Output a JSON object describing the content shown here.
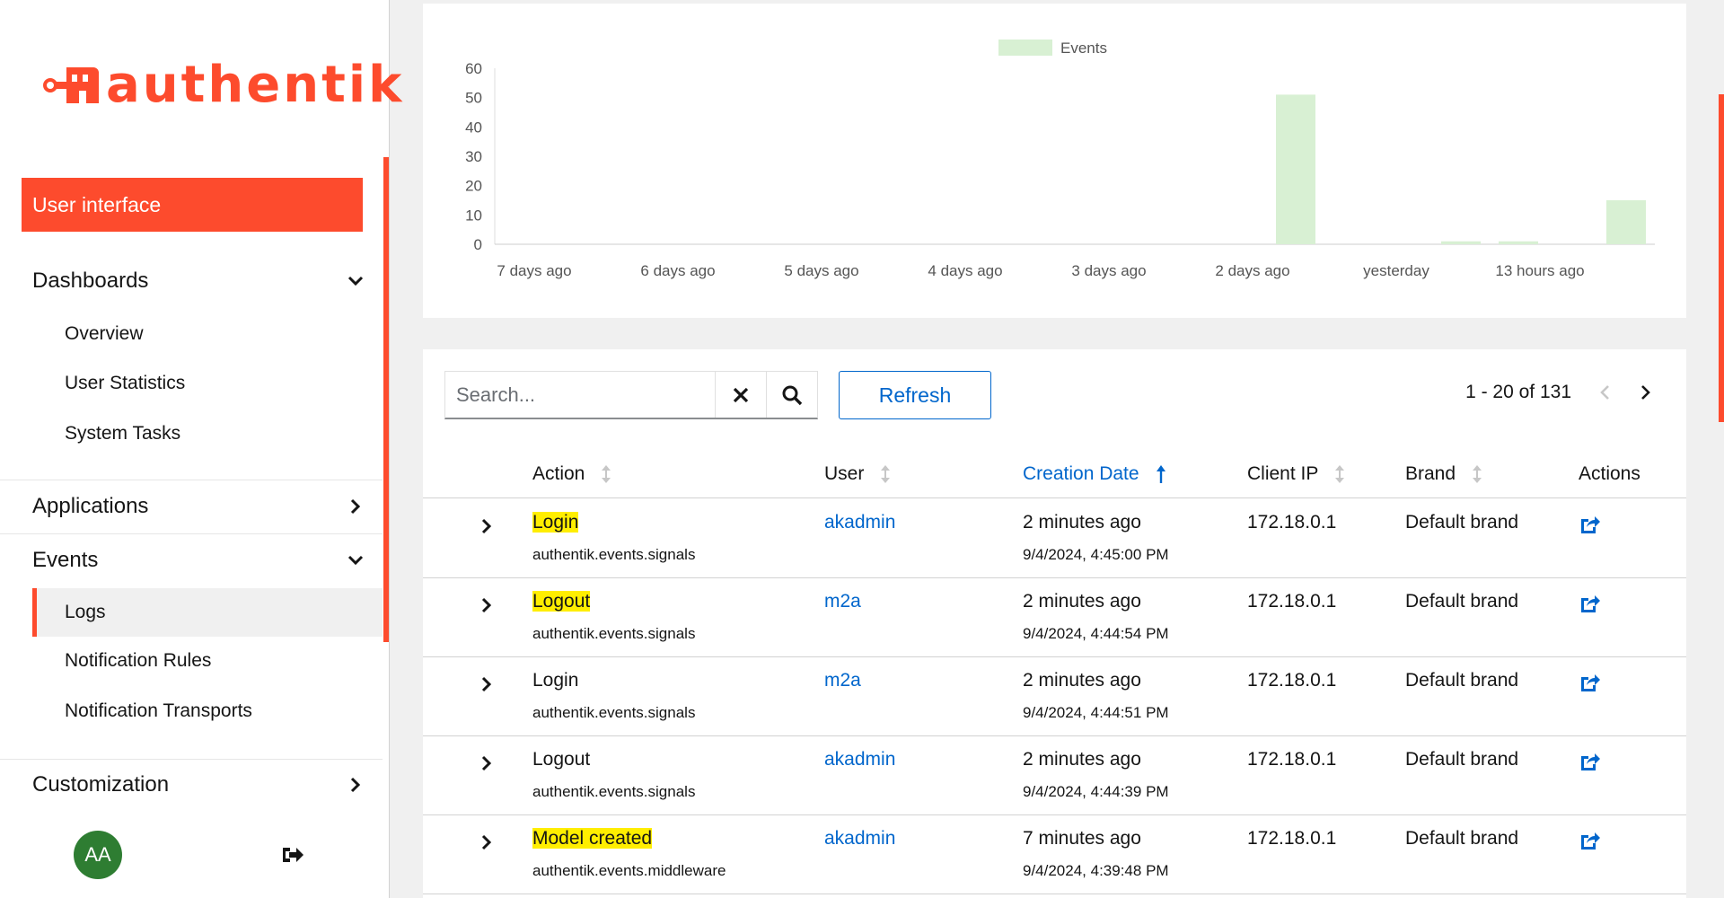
{
  "brand": {
    "logo_text": "authentik",
    "accent": "#fd4b2d"
  },
  "sidebar": {
    "user_interface": "User interface",
    "groups": {
      "dashboards": "Dashboards",
      "applications": "Applications",
      "events": "Events",
      "customization": "Customization"
    },
    "dashboards_items": [
      "Overview",
      "User Statistics",
      "System Tasks"
    ],
    "events_items": [
      "Logs",
      "Notification Rules",
      "Notification Transports"
    ],
    "active_item": "Logs",
    "avatar_initials": "AA"
  },
  "chart_data": {
    "type": "bar",
    "legend": "Events",
    "categories": [
      "7 days ago",
      "6 days ago",
      "5 days ago",
      "4 days ago",
      "3 days ago",
      "2 days ago",
      "yesterday",
      "13 hours ago"
    ],
    "ylim": [
      0,
      60
    ],
    "yticks": [
      0,
      10,
      20,
      30,
      40,
      50,
      60
    ],
    "bars": [
      {
        "x": 5.3,
        "value": 51
      },
      {
        "x": 6.45,
        "value": 1
      },
      {
        "x": 6.85,
        "value": 1
      },
      {
        "x": 7.6,
        "value": 15
      }
    ],
    "bar_color": "#d8f0d3"
  },
  "toolbar": {
    "search_placeholder": "Search...",
    "refresh_label": "Refresh",
    "pagination": "1 - 20 of 131"
  },
  "table": {
    "columns": {
      "action": "Action",
      "user": "User",
      "creation_date": "Creation Date",
      "client_ip": "Client IP",
      "brand": "Brand",
      "actions": "Actions"
    },
    "rows": [
      {
        "action": "Login",
        "highlight": true,
        "app": "authentik.events.signals",
        "user": "akadmin",
        "rel": "2 minutes ago",
        "abs": "9/4/2024, 4:45:00 PM",
        "ip": "172.18.0.1",
        "brand": "Default brand"
      },
      {
        "action": "Logout",
        "highlight": true,
        "app": "authentik.events.signals",
        "user": "m2a",
        "rel": "2 minutes ago",
        "abs": "9/4/2024, 4:44:54 PM",
        "ip": "172.18.0.1",
        "brand": "Default brand"
      },
      {
        "action": "Login",
        "highlight": false,
        "app": "authentik.events.signals",
        "user": "m2a",
        "rel": "2 minutes ago",
        "abs": "9/4/2024, 4:44:51 PM",
        "ip": "172.18.0.1",
        "brand": "Default brand"
      },
      {
        "action": "Logout",
        "highlight": false,
        "app": "authentik.events.signals",
        "user": "akadmin",
        "rel": "2 minutes ago",
        "abs": "9/4/2024, 4:44:39 PM",
        "ip": "172.18.0.1",
        "brand": "Default brand"
      },
      {
        "action": "Model created",
        "highlight": true,
        "app": "authentik.events.middleware",
        "user": "akadmin",
        "rel": "7 minutes ago",
        "abs": "9/4/2024, 4:39:48 PM",
        "ip": "172.18.0.1",
        "brand": "Default brand"
      }
    ]
  }
}
